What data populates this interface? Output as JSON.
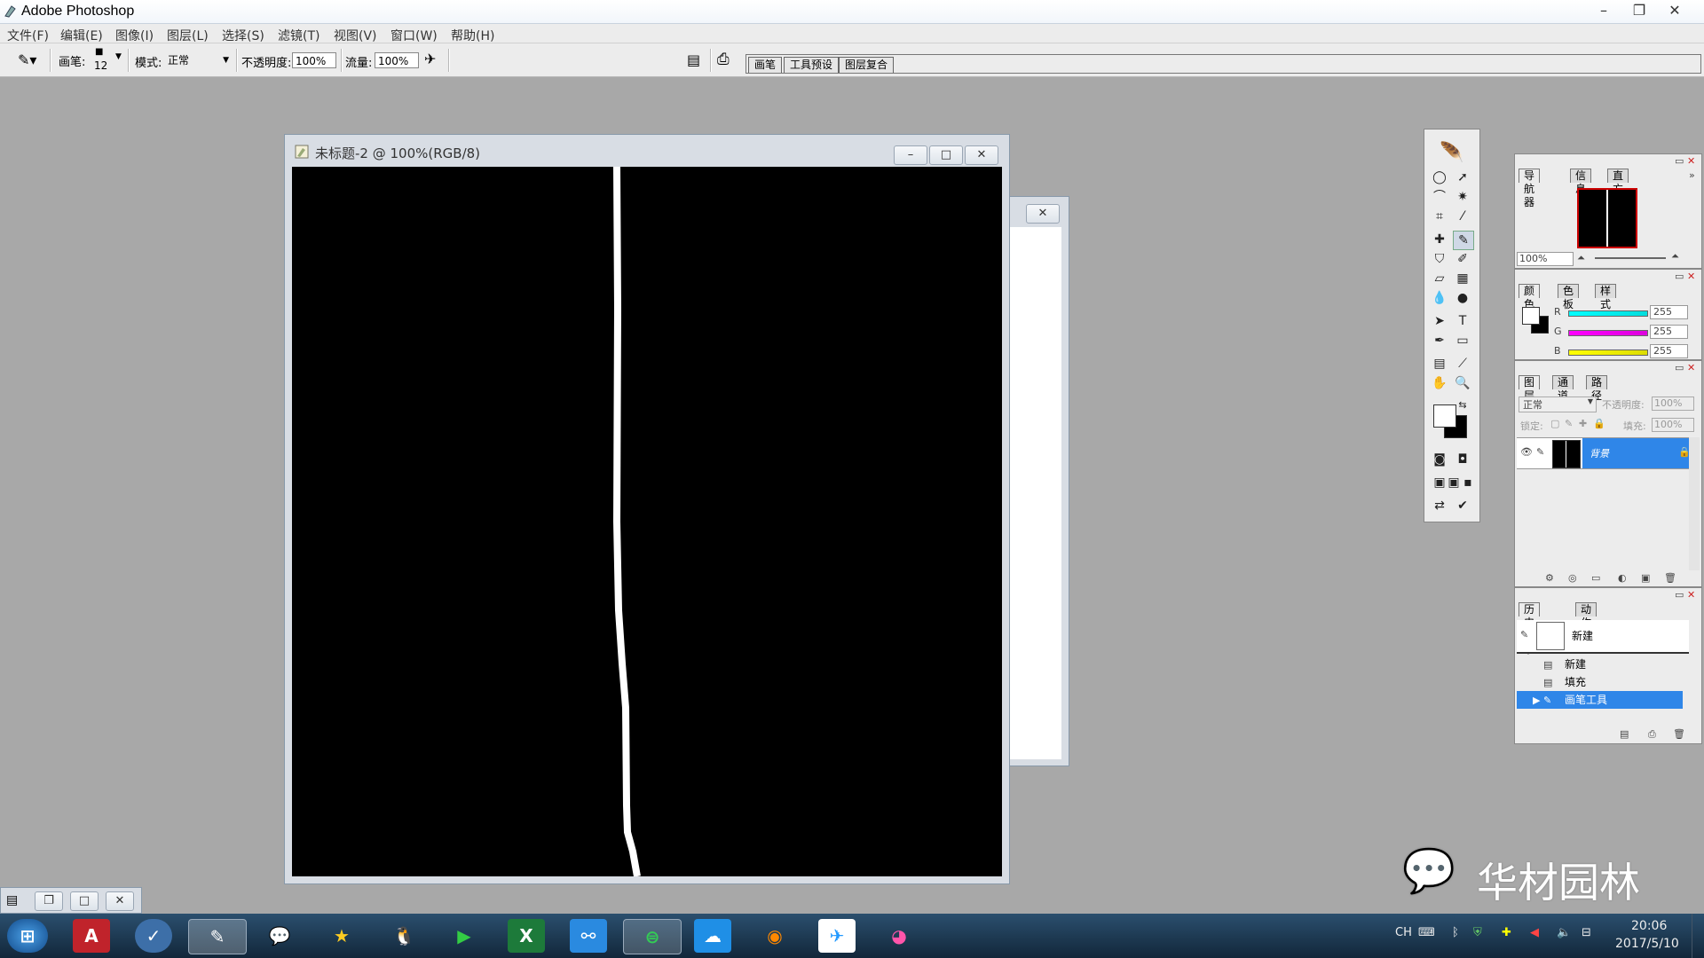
{
  "app": {
    "title": "Adobe Photoshop"
  },
  "menu": [
    "文件(F)",
    "编辑(E)",
    "图像(I)",
    "图层(L)",
    "选择(S)",
    "滤镜(T)",
    "视图(V)",
    "窗口(W)",
    "帮助(H)"
  ],
  "options": {
    "brush_label": "画笔:",
    "brush_size": "12",
    "mode_label": "模式:",
    "mode_value": "正常",
    "opacity_label": "不透明度:",
    "opacity_value": "100%",
    "flow_label": "流量:",
    "flow_value": "100%"
  },
  "palette_well_tabs": [
    "画笔",
    "工具预设",
    "图层复合"
  ],
  "document": {
    "title": "未标题-2 @ 100%(RGB/8)"
  },
  "navigator": {
    "tabs": [
      "导航器",
      "信息",
      "直方图"
    ],
    "zoom": "100%"
  },
  "color": {
    "tabs": [
      "颜色",
      "色板",
      "样式"
    ],
    "r_label": "R",
    "g_label": "G",
    "b_label": "B",
    "r": "255",
    "g": "255",
    "b": "255"
  },
  "layers": {
    "tabs": [
      "图层",
      "通道",
      "路径"
    ],
    "blend_mode": "正常",
    "opacity_label": "不透明度:",
    "opacity": "100%",
    "lock_label": "锁定:",
    "fill_label": "填充:",
    "fill": "100%",
    "layer_name": "背景"
  },
  "history": {
    "tabs": [
      "历史记录",
      "动作"
    ],
    "snapshot": "新建",
    "items": [
      "新建",
      "填充",
      "画笔工具"
    ]
  },
  "taskbar": {
    "tray_lang": "CH",
    "time": "20:06",
    "date": "2017/5/10"
  },
  "watermark": "华材园林",
  "colors": {
    "selection": "#2f86e8",
    "canvas": "#000000",
    "stroke": "#ffffff"
  }
}
